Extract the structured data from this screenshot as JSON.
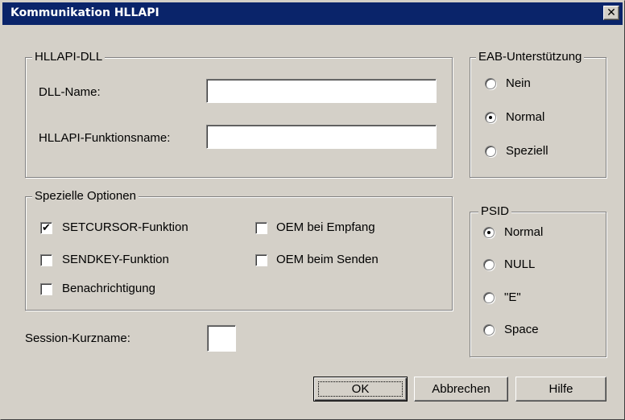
{
  "window": {
    "title": "Kommunikation HLLAPI",
    "close_glyph": "✕"
  },
  "hllapi_dll": {
    "legend": "HLLAPI-DLL",
    "dll_name_label": "DLL-Name:",
    "dll_name_value": "",
    "func_name_label": "HLLAPI-Funktionsname:",
    "func_name_value": ""
  },
  "eab": {
    "legend": "EAB-Unterstützung",
    "options": [
      {
        "label": "Nein",
        "checked": false
      },
      {
        "label": "Normal",
        "checked": true
      },
      {
        "label": "Speziell",
        "checked": false
      }
    ]
  },
  "special_options": {
    "legend": "Spezielle Optionen",
    "items": [
      {
        "label": "SETCURSOR-Funktion",
        "checked": true
      },
      {
        "label": "SENDKEY-Funktion",
        "checked": false
      },
      {
        "label": "Benachrichtigung",
        "checked": false
      },
      {
        "label": "OEM bei Empfang",
        "checked": false
      },
      {
        "label": "OEM beim Senden",
        "checked": false
      }
    ]
  },
  "psid": {
    "legend": "PSID",
    "options": [
      {
        "label": "Normal",
        "checked": true
      },
      {
        "label": "NULL",
        "checked": false
      },
      {
        "label": "\"E\"",
        "checked": false
      },
      {
        "label": "Space",
        "checked": false
      }
    ]
  },
  "session": {
    "label": "Session-Kurzname:",
    "value": ""
  },
  "buttons": {
    "ok": "OK",
    "cancel": "Abbrechen",
    "help": "Hilfe"
  },
  "check_glyph": "✔"
}
